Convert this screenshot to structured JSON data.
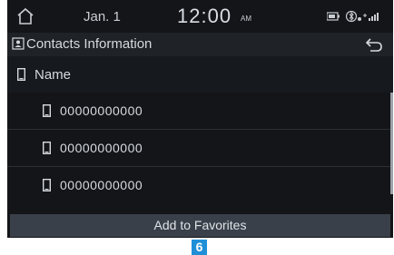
{
  "status_bar": {
    "date": "Jan.  1",
    "time": "12:00",
    "ampm": "AM"
  },
  "title_bar": {
    "title": "Contacts Information"
  },
  "name_row": {
    "label": "Name"
  },
  "numbers": [
    "00000000000",
    "00000000000",
    "00000000000"
  ],
  "button": {
    "label": "Add to Favorites"
  },
  "callout": {
    "number": "6"
  },
  "colors": {
    "background": "#131518",
    "button": "#3a4049",
    "callout": "#1f8fd8"
  },
  "icons": [
    "home-icon",
    "contact-card-icon",
    "back-arrow-icon",
    "phone-icon",
    "battery-icon",
    "bluetooth-icon",
    "signal-icon"
  ]
}
